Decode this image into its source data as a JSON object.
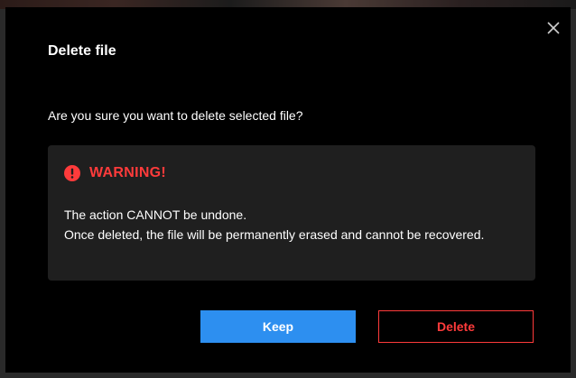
{
  "dialog": {
    "title": "Delete file",
    "question": "Are you sure you want to delete selected file?",
    "close_icon": "close-icon"
  },
  "warning": {
    "icon": "exclamation-circle-icon",
    "title": "WARNING!",
    "line1": "The action CANNOT be undone.",
    "line2": "Once deleted, the file will be permanently erased and cannot be recovered."
  },
  "buttons": {
    "keep_label": "Keep",
    "delete_label": "Delete"
  },
  "colors": {
    "background": "#000000",
    "warning_box": "#1f1f1f",
    "warning_red": "#ff3b3b",
    "primary_blue": "#2d8ff0",
    "text": "#ffffff"
  }
}
